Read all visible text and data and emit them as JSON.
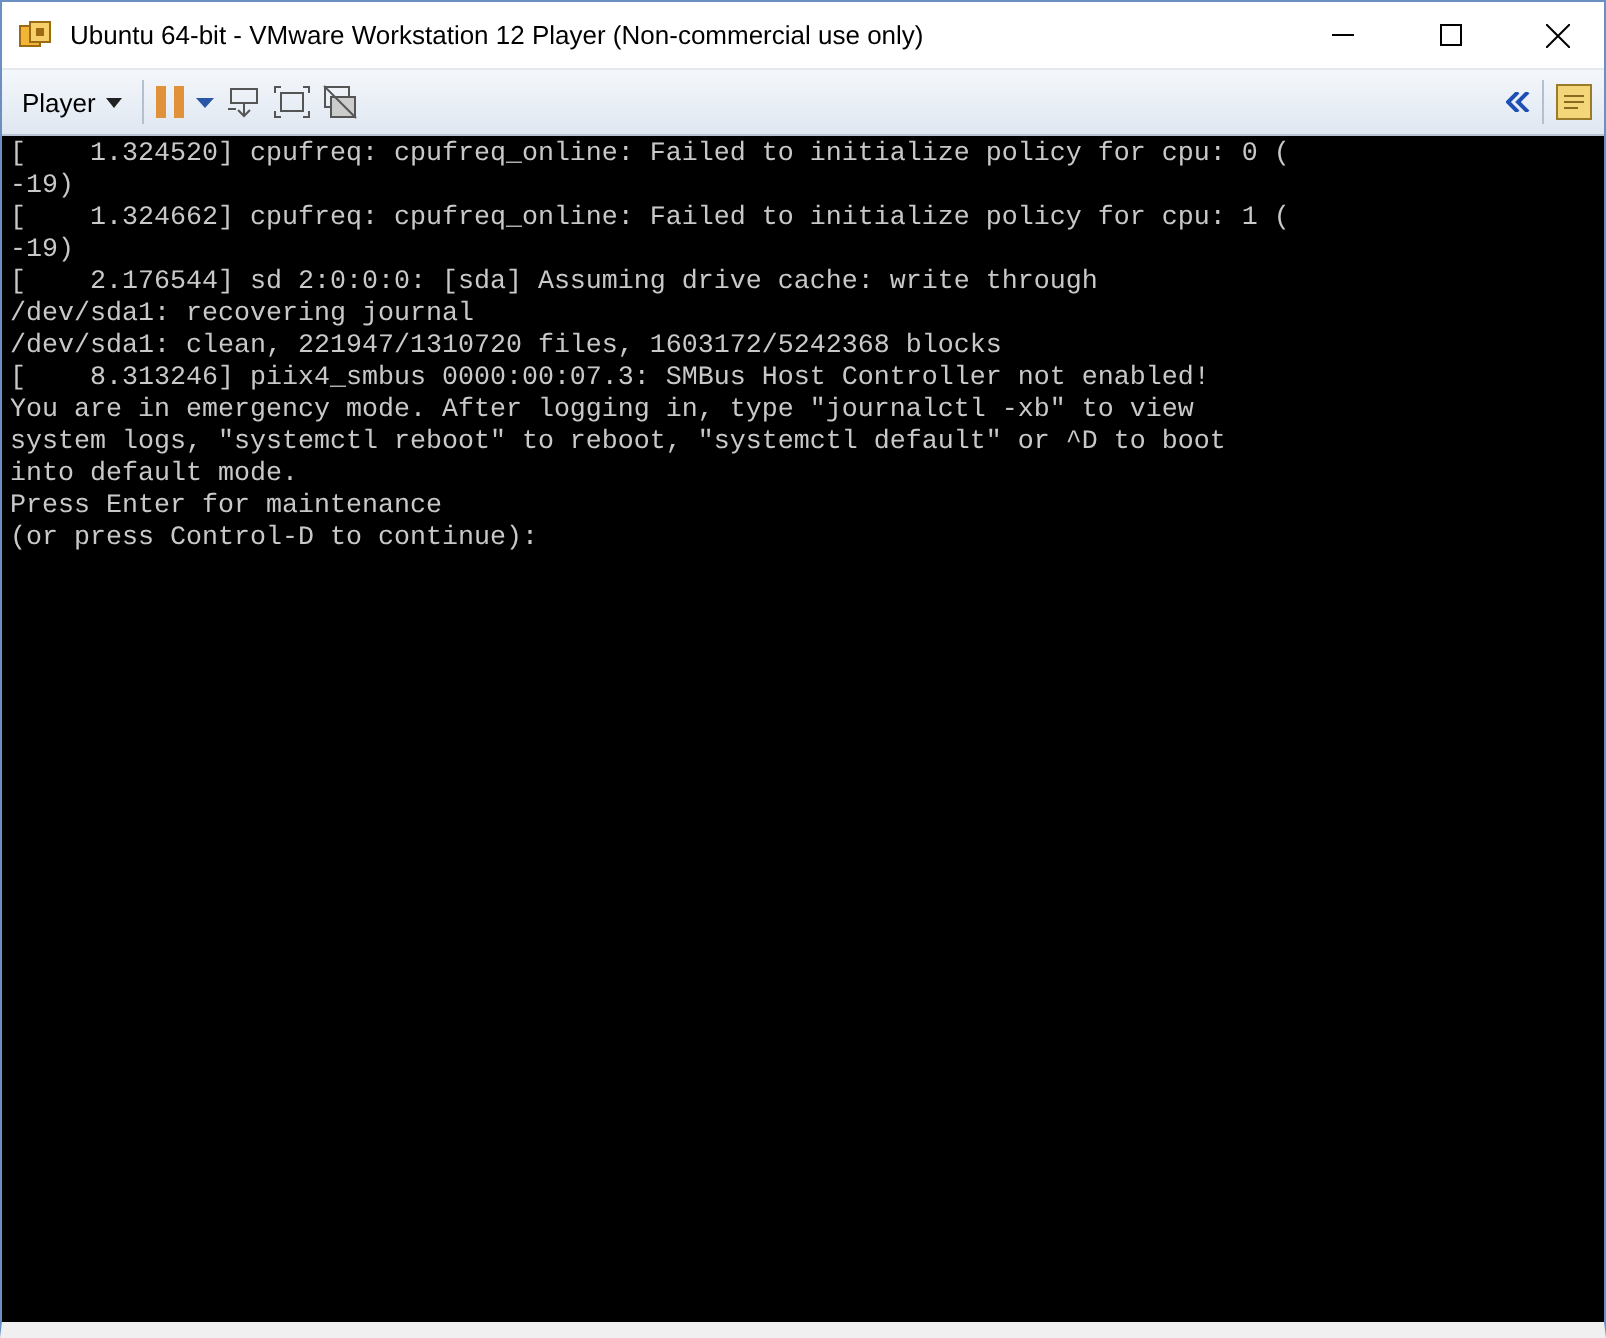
{
  "window": {
    "title": "Ubuntu 64-bit - VMware Workstation 12 Player (Non-commercial use only)"
  },
  "toolbar": {
    "player_menu": "Player"
  },
  "console": {
    "lines": [
      "[    1.324520] cpufreq: cpufreq_online: Failed to initialize policy for cpu: 0 (",
      "-19)",
      "[    1.324662] cpufreq: cpufreq_online: Failed to initialize policy for cpu: 1 (",
      "-19)",
      "[    2.176544] sd 2:0:0:0: [sda] Assuming drive cache: write through",
      "/dev/sda1: recovering journal",
      "/dev/sda1: clean, 221947/1310720 files, 1603172/5242368 blocks",
      "[    8.313246] piix4_smbus 0000:00:07.3: SMBus Host Controller not enabled!",
      "You are in emergency mode. After logging in, type \"journalctl -xb\" to view",
      "system logs, \"systemctl reboot\" to reboot, \"systemctl default\" or ^D to boot",
      "into default mode.",
      "Press Enter for maintenance",
      "(or press Control-D to continue):"
    ]
  }
}
